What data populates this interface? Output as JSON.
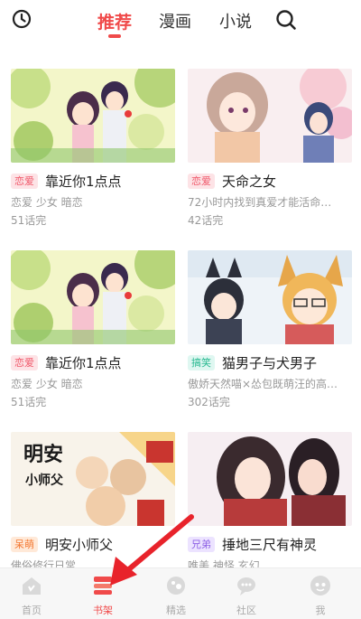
{
  "tabs": [
    {
      "label": "推荐"
    },
    {
      "label": "漫画"
    },
    {
      "label": "小说"
    }
  ],
  "cards": [
    {
      "tag": "恋爱",
      "tag_color": "pink",
      "title": "靠近你1点点",
      "subtitle": "恋爱 少女 暗恋",
      "chapters": "51话完"
    },
    {
      "tag": "恋爱",
      "tag_color": "pink",
      "title": "天命之女",
      "subtitle": "72小时内找到真爱才能活命…",
      "chapters": "42话完"
    },
    {
      "tag": "恋爱",
      "tag_color": "pink",
      "title": "靠近你1点点",
      "subtitle": "恋爱 少女 暗恋",
      "chapters": "51话完"
    },
    {
      "tag": "搞笑",
      "tag_color": "teal",
      "title": "猫男子与犬男子",
      "subtitle": "傲娇天然喵×怂包既萌汪的高…",
      "chapters": "302话完"
    },
    {
      "tag": "呆萌",
      "tag_color": "orange",
      "title": "明安小师父",
      "subtitle": "佛俗修行日常",
      "chapters": ""
    },
    {
      "tag": "兄弟",
      "tag_color": "purple",
      "title": "捶地三尺有神灵",
      "subtitle": "唯美 神怪 玄幻",
      "chapters": ""
    }
  ],
  "cover_text": {
    "big": "明安",
    "small": "小师父"
  },
  "nav": [
    {
      "label": "首页",
      "icon": "home-icon"
    },
    {
      "label": "书架",
      "icon": "bookshelf-icon"
    },
    {
      "label": "精选",
      "icon": "featured-icon"
    },
    {
      "label": "社区",
      "icon": "community-icon"
    },
    {
      "label": "我",
      "icon": "profile-icon"
    }
  ],
  "colors": {
    "accent": "#f04a4a",
    "arrow": "#e8232b"
  }
}
